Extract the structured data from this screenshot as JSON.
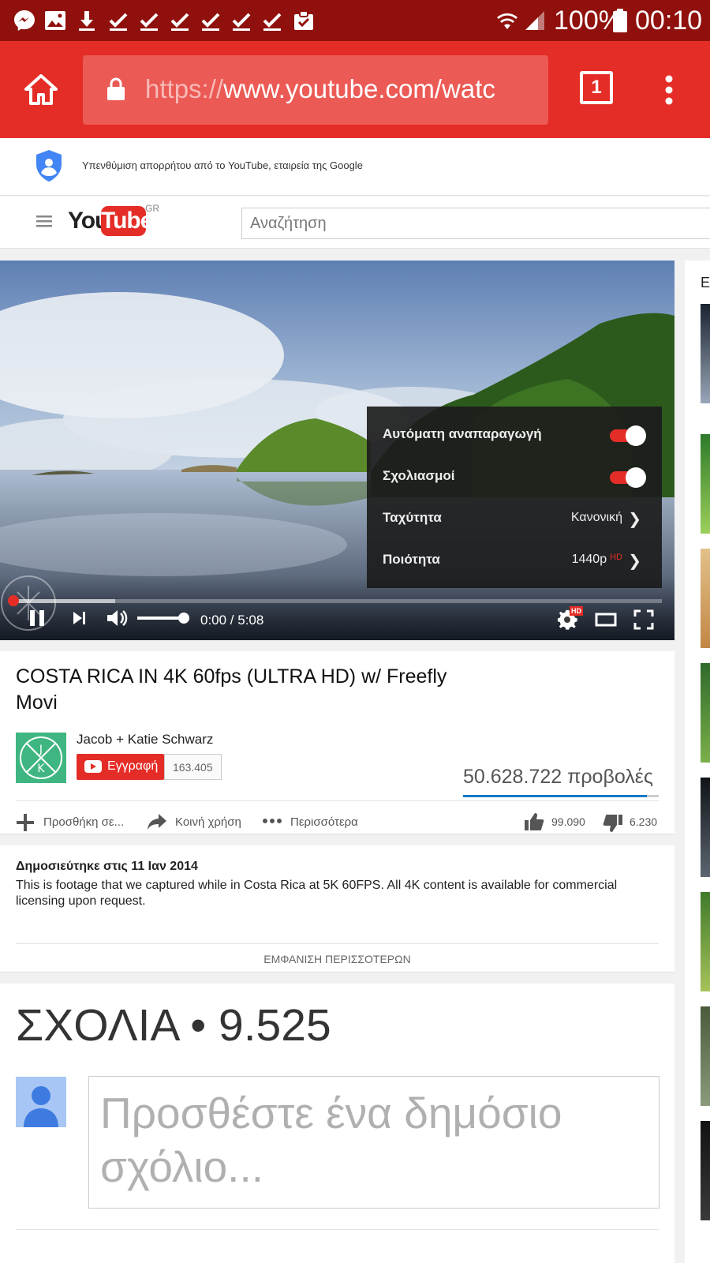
{
  "status_bar": {
    "battery": "100%",
    "time": "00:10"
  },
  "browser": {
    "url_scheme": "https://",
    "url_rest": "www.youtube.com/watc",
    "tab_count": "1"
  },
  "privacy_banner": {
    "text": "Υπενθύμιση απορρήτου από το YouTube, εταιρεία της Google"
  },
  "masthead": {
    "logo_you": "You",
    "logo_tube": "Tube",
    "region": "GR",
    "search_placeholder": "Αναζήτηση"
  },
  "player": {
    "progress_fraction": 0.0,
    "buffered_fraction": 0.16,
    "volume_fraction": 0.9,
    "time": "0:00 / 5:08",
    "settings_menu": {
      "autoplay": {
        "label": "Αυτόματη αναπαραγωγή",
        "on": true
      },
      "annotations": {
        "label": "Σχολιασμοί",
        "on": true
      },
      "speed": {
        "label": "Ταχύτητα",
        "value": "Κανονική"
      },
      "quality": {
        "label": "Ποιότητα",
        "value": "1440p",
        "badge": "HD"
      }
    },
    "settings_badge": "HD"
  },
  "video": {
    "title": "COSTA RICA IN 4K 60fps (ULTRA HD) w/ Freefly Movi",
    "channel": "Jacob + Katie Schwarz",
    "subscribe_label": "Εγγραφή",
    "subscriber_count": "163.405",
    "views": "50.628.722 προβολές",
    "like_ratio": 0.94,
    "actions": {
      "add_to": "Προσθήκη σε...",
      "share": "Κοινή χρήση",
      "more": "Περισσότερα"
    },
    "likes": "99.090",
    "dislikes": "6.230"
  },
  "description": {
    "published": "Δημοσιεύτηκε στις 11 Ιαν 2014",
    "text": "This is footage that we captured while in Costa Rica at 5K 60FPS. All 4K content is available for commercial licensing upon request.",
    "show_more": "ΕΜΦΑΝΙΣΗ ΠΕΡΙΣΣΟΤΕΡΩΝ"
  },
  "comments": {
    "title": "ΣΧΟΛΙΑ",
    "separator": "•",
    "count": "9.525",
    "placeholder": "Προσθέστε ένα δημόσιο σχόλιο..."
  },
  "sidebar": {
    "heading": "Ε"
  },
  "colors": {
    "brand_red": "#e52d27",
    "status_bar": "#8f100c",
    "link_blue": "#167ac6"
  }
}
